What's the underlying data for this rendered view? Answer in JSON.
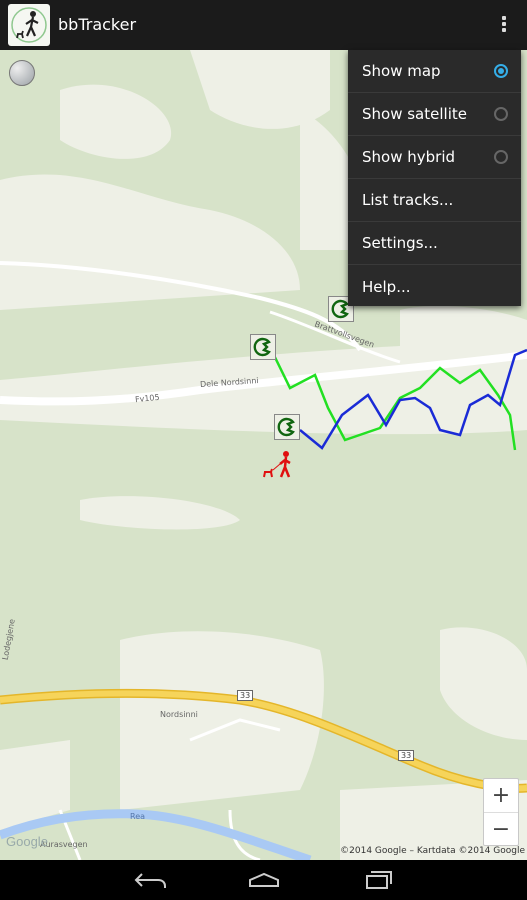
{
  "app": {
    "title": "bbTracker"
  },
  "menu": {
    "items": [
      {
        "label": "Show map",
        "radio": true,
        "selected": true
      },
      {
        "label": "Show satellite",
        "radio": true,
        "selected": false
      },
      {
        "label": "Show hybrid",
        "radio": true,
        "selected": false
      },
      {
        "label": "List tracks...",
        "radio": false
      },
      {
        "label": "Settings...",
        "radio": false
      },
      {
        "label": "Help...",
        "radio": false
      }
    ]
  },
  "map": {
    "labels": {
      "road_fv105": "Fv105",
      "road_nordsinni_upper": "Dele Nordsinni",
      "road_brattvall": "Brattvollsvegen",
      "road_nordsinni_lower": "Nordsinni",
      "route_33a": "33",
      "route_33b": "33",
      "road_veg": "Aurasvegen",
      "road_lodgin": "Lodegjene",
      "river": "Rea"
    },
    "copyright": "©2014 Google – Kartdata ©2014 Google",
    "google_logo": "Google",
    "zoom_in": "+",
    "zoom_out": "−",
    "track_colors": {
      "green": "#22e022",
      "blue": "#1a2bd6",
      "walker": "#e01010"
    }
  },
  "icons": {
    "app": "walker-dog-icon",
    "overflow": "overflow-menu-icon",
    "compass": "compass-icon",
    "waypoint": "waypoint-icon",
    "walker": "walker-icon",
    "back": "back-icon",
    "home": "home-icon",
    "recents": "recents-icon"
  }
}
